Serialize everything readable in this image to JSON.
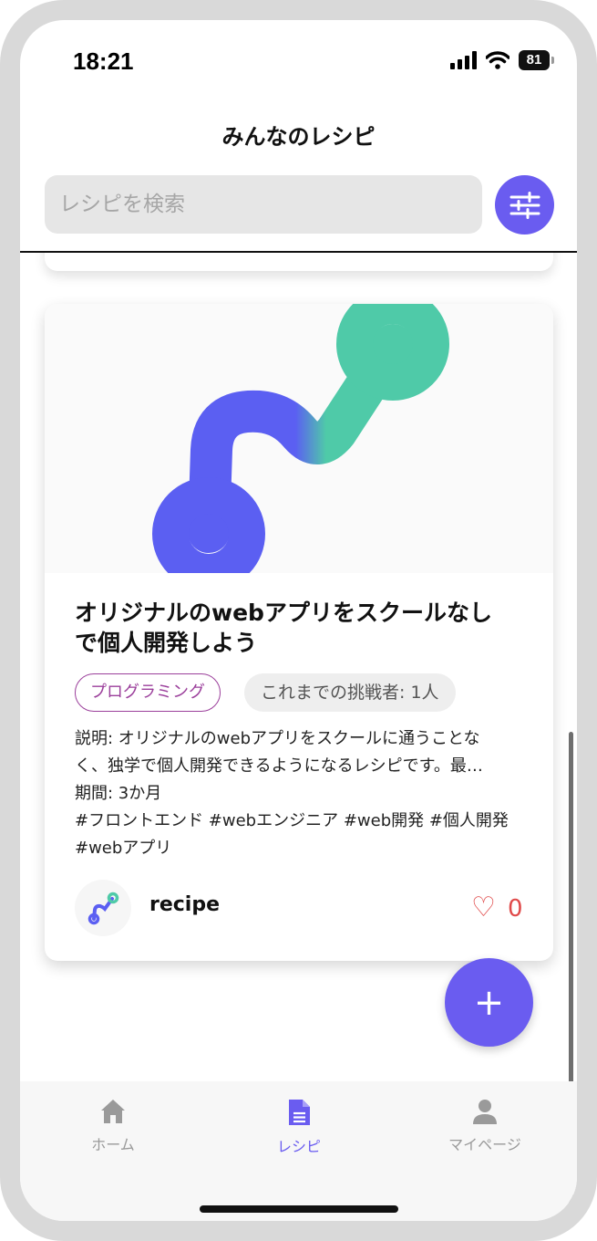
{
  "status_bar": {
    "time": "18:21",
    "battery": "81"
  },
  "header": {
    "title": "みんなのレシピ"
  },
  "search": {
    "placeholder": "レシピを検索"
  },
  "recipe_card": {
    "title_line1": "オリジナルのwebアプリをスクールなし",
    "title_line2": "で個人開発しよう",
    "category_tag": "プログラミング",
    "challengers": "これまでの挑戦者: 1人",
    "description_line1": "説明: オリジナルのwebアプリをスクールに通うことな",
    "description_line2": "く、独学で個人開発できるようになるレシピです。最…",
    "period": "期間: 3か月",
    "hashtags_line1": "#フロントエンド #webエンジニア #web開発 #個人開発",
    "hashtags_line2": "#webアプリ",
    "author": "recipe",
    "like_count": "0"
  },
  "fab": {
    "label": "+"
  },
  "tabbar": {
    "items": [
      {
        "label": "ホーム",
        "icon": "home-icon",
        "active": false
      },
      {
        "label": "レシピ",
        "icon": "document-icon",
        "active": true
      },
      {
        "label": "マイページ",
        "icon": "person-icon",
        "active": false
      }
    ]
  },
  "colors": {
    "accent": "#6a5cf0",
    "tag": "#9b3f9b",
    "like": "#e04a4a",
    "logo_teal": "#4fcaa8"
  }
}
